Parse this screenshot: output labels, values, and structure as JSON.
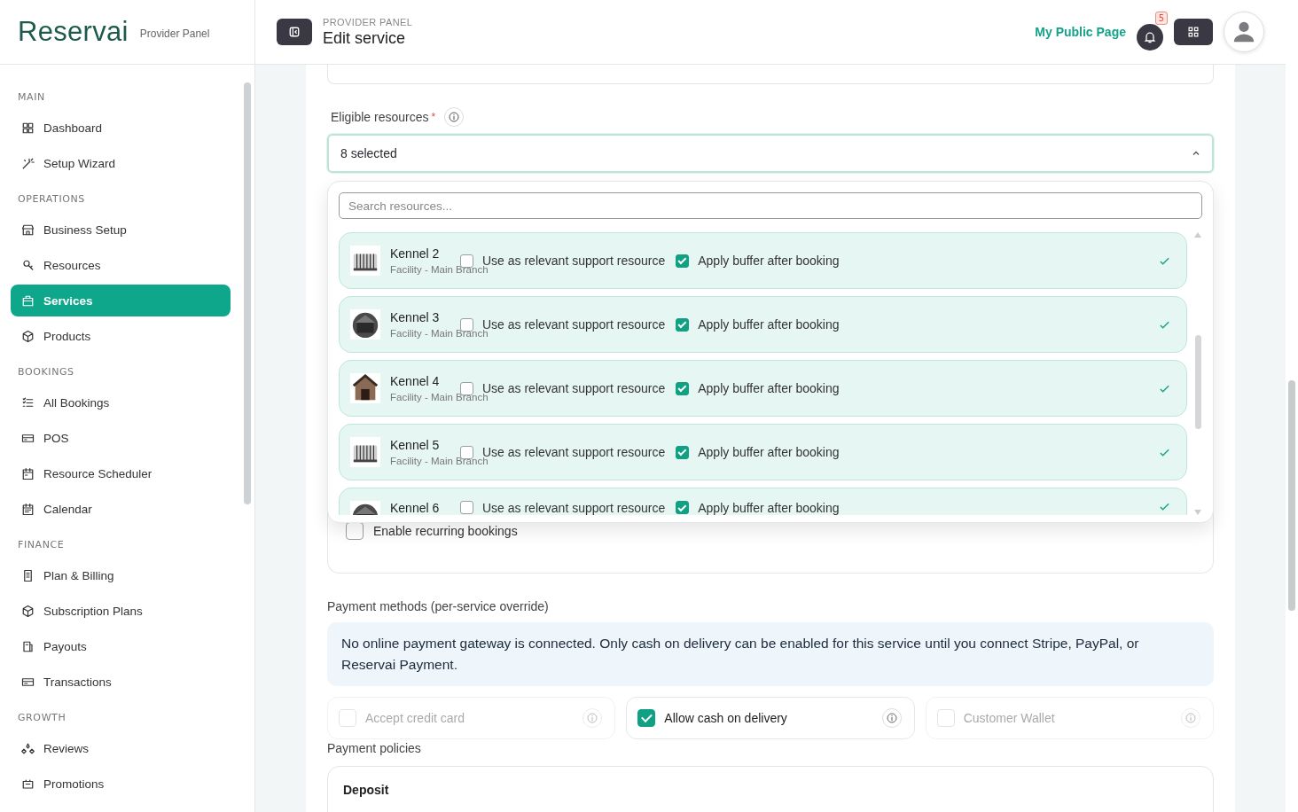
{
  "brand": {
    "logo": "Reservai",
    "subtitle": "Provider Panel"
  },
  "sidebar": {
    "sections": [
      {
        "title": "MAIN",
        "items": [
          {
            "label": "Dashboard",
            "selected": false
          },
          {
            "label": "Setup Wizard",
            "selected": false
          }
        ]
      },
      {
        "title": "OPERATIONS",
        "items": [
          {
            "label": "Business Setup",
            "selected": false
          },
          {
            "label": "Resources",
            "selected": false
          },
          {
            "label": "Services",
            "selected": true
          },
          {
            "label": "Products",
            "selected": false
          }
        ]
      },
      {
        "title": "BOOKINGS",
        "items": [
          {
            "label": "All Bookings",
            "selected": false
          },
          {
            "label": "POS",
            "selected": false
          },
          {
            "label": "Resource Scheduler",
            "selected": false
          },
          {
            "label": "Calendar",
            "selected": false
          }
        ]
      },
      {
        "title": "FINANCE",
        "items": [
          {
            "label": "Plan & Billing",
            "selected": false
          },
          {
            "label": "Subscription Plans",
            "selected": false
          },
          {
            "label": "Payouts",
            "selected": false
          },
          {
            "label": "Transactions",
            "selected": false
          }
        ]
      },
      {
        "title": "GROWTH",
        "items": [
          {
            "label": "Reviews",
            "selected": false
          },
          {
            "label": "Promotions",
            "selected": false
          }
        ]
      }
    ]
  },
  "header": {
    "kicker": "PROVIDER PANEL",
    "title": "Edit service",
    "public_link": "My Public Page",
    "notification_count": "5"
  },
  "eligible": {
    "label": "Eligible resources",
    "required_mark": "*",
    "value": "8 selected",
    "expanded": true,
    "search_placeholder": "Search resources...",
    "resources": [
      {
        "name": "Kennel 2",
        "subtitle": "Facility - Main Branch",
        "support_label": "Use as relevant support resource",
        "support_checked": false,
        "buffer_label": "Apply buffer after booking",
        "buffer_checked": true,
        "selected": true
      },
      {
        "name": "Kennel 3",
        "subtitle": "Facility - Main Branch",
        "support_label": "Use as relevant support resource",
        "support_checked": false,
        "buffer_label": "Apply buffer after booking",
        "buffer_checked": true,
        "selected": true
      },
      {
        "name": "Kennel 4",
        "subtitle": "Facility - Main Branch",
        "support_label": "Use as relevant support resource",
        "support_checked": false,
        "buffer_label": "Apply buffer after booking",
        "buffer_checked": true,
        "selected": true
      },
      {
        "name": "Kennel 5",
        "subtitle": "Facility - Main Branch",
        "support_label": "Use as relevant support resource",
        "support_checked": false,
        "buffer_label": "Apply buffer after booking",
        "buffer_checked": true,
        "selected": true
      },
      {
        "name": "Kennel 6",
        "support_label": "Use as relevant support resource",
        "support_checked": false,
        "buffer_label": "Apply buffer after booking",
        "buffer_checked": true,
        "selected": true
      }
    ]
  },
  "recurring": {
    "label": "Enable recurring bookings",
    "checked": false
  },
  "payment_methods": {
    "title": "Payment methods (per-service override)",
    "notice": "No online payment gateway is connected. Only cash on delivery can be enabled for this service until you connect Stripe, PayPal, or Reservai Payment.",
    "options": [
      {
        "label": "Accept credit card",
        "checked": false,
        "disabled": true
      },
      {
        "label": "Allow cash on delivery",
        "checked": true,
        "disabled": false
      },
      {
        "label": "Customer Wallet",
        "checked": false,
        "disabled": true
      }
    ]
  },
  "payment_policies": {
    "title": "Payment policies",
    "deposit_title": "Deposit"
  }
}
